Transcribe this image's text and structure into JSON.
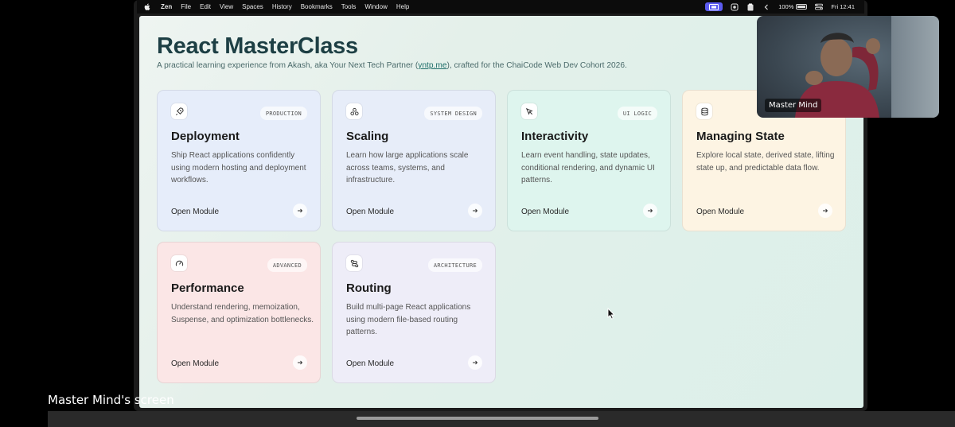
{
  "menubar": {
    "app_name": "Zen",
    "items": [
      "File",
      "Edit",
      "View",
      "Spaces",
      "History",
      "Bookmarks",
      "Tools",
      "Window",
      "Help"
    ],
    "battery": "100%",
    "clock": "Fri 12:41"
  },
  "page": {
    "title": "React MasterClass",
    "subtitle_before": "A practical learning experience from Akash, aka Your Next Tech Partner (",
    "subtitle_link": "yntp.me",
    "subtitle_after": "), crafted for the ChaiCode Web Dev Cohort 2026."
  },
  "cards": [
    {
      "tag": "PRODUCTION",
      "title": "Deployment",
      "desc": "Ship React applications confidently using modern hosting and deployment workflows.",
      "cta": "Open Module",
      "icon": "rocket-icon",
      "bg": "#e6edfa"
    },
    {
      "tag": "SYSTEM DESIGN",
      "title": "Scaling",
      "desc": "Learn how large applications scale across teams, systems, and infrastructure.",
      "cta": "Open Module",
      "icon": "network-icon",
      "bg": "#e7edf9"
    },
    {
      "tag": "UI LOGIC",
      "title": "Interactivity",
      "desc": "Learn event handling, state updates, conditional rendering, and dynamic UI patterns.",
      "cta": "Open Module",
      "icon": "pointer-icon",
      "bg": "#def5ee"
    },
    {
      "tag": "",
      "title": "Managing State",
      "desc": "Explore local state, derived state, lifting state up, and predictable data flow.",
      "cta": "Open Module",
      "icon": "database-icon",
      "bg": "#fdf4e3"
    },
    {
      "tag": "ADVANCED",
      "title": "Performance",
      "desc": "Understand rendering, memoization, Suspense, and optimization bottlenecks.",
      "cta": "Open Module",
      "icon": "gauge-icon",
      "bg": "#fbe6e6"
    },
    {
      "tag": "ARCHITECTURE",
      "title": "Routing",
      "desc": "Build multi-page React applications using modern file-based routing patterns.",
      "cta": "Open Module",
      "icon": "route-icon",
      "bg": "#eeedf8"
    }
  ],
  "video": {
    "participant_name": "Master Mind"
  },
  "caption": "Master Mind's screen",
  "colors": {
    "title": "#1d3f44",
    "accent_link": "#1f6f6a",
    "menubar_pill": "#5b5bf0"
  }
}
